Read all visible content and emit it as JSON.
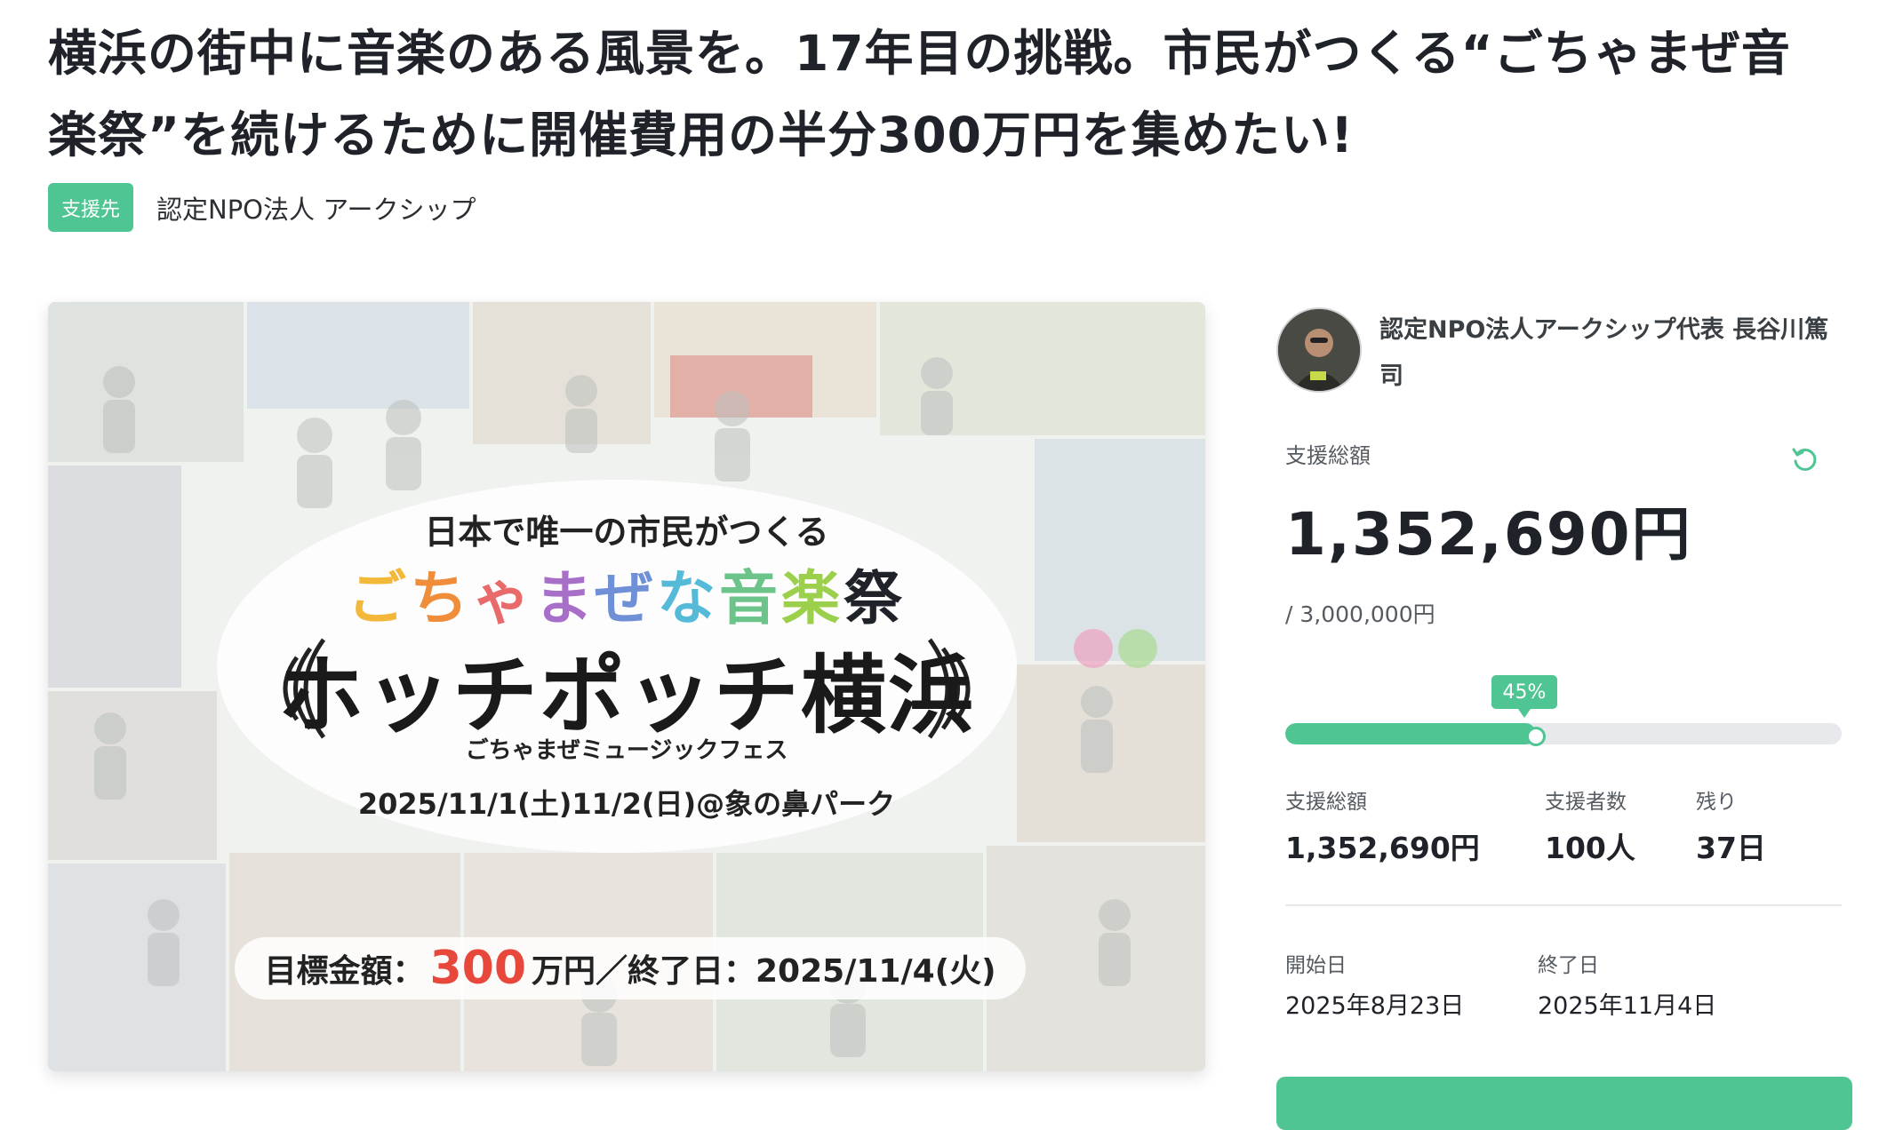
{
  "project": {
    "title": "横浜の街中に音楽のある風景を。17年目の挑戦。市民がつくる“ごちゃまぜ音楽祭”を続けるために開催費用の半分300万円を集めたい!",
    "badge_label": "支援先",
    "organization": "認定NPO法人 アークシップ"
  },
  "hero": {
    "line1": "日本で唯一の市民がつくる",
    "line2_chars": [
      "ご",
      "ち",
      "ゃ",
      "ま",
      "ぜ",
      "な",
      "音",
      "楽",
      "祭"
    ],
    "logo": "ホッチポッチ横浜",
    "logo_sub": "ごちゃまぜミュージックフェス",
    "date_place": "2025/11/1(土)11/2(日)@象の鼻パーク",
    "target_label": "目標金額：",
    "target_amount": "300",
    "target_unit": "万円／終了日：2025/11/4(火)"
  },
  "owner": {
    "name": "認定NPO法人アークシップ代表 長谷川篤司",
    "avatar_icon": "avatar-photo"
  },
  "funding": {
    "total_label": "支援総額",
    "total_amount": "1,352,690円",
    "goal": "/ 3,000,000円",
    "percent_label": "45%",
    "percent": 45,
    "refresh_icon": "refresh-icon",
    "stats": [
      {
        "label": "支援総額",
        "value": "1,352,690円"
      },
      {
        "label": "支援者数",
        "value": "100人"
      },
      {
        "label": "残り",
        "value": "37日"
      }
    ],
    "start_label": "開始日",
    "start_date": "2025年8月23日",
    "end_label": "終了日",
    "end_date": "2025年11月4日"
  },
  "colors": {
    "accent": "#4fc593",
    "target_red": "#e8473c"
  }
}
